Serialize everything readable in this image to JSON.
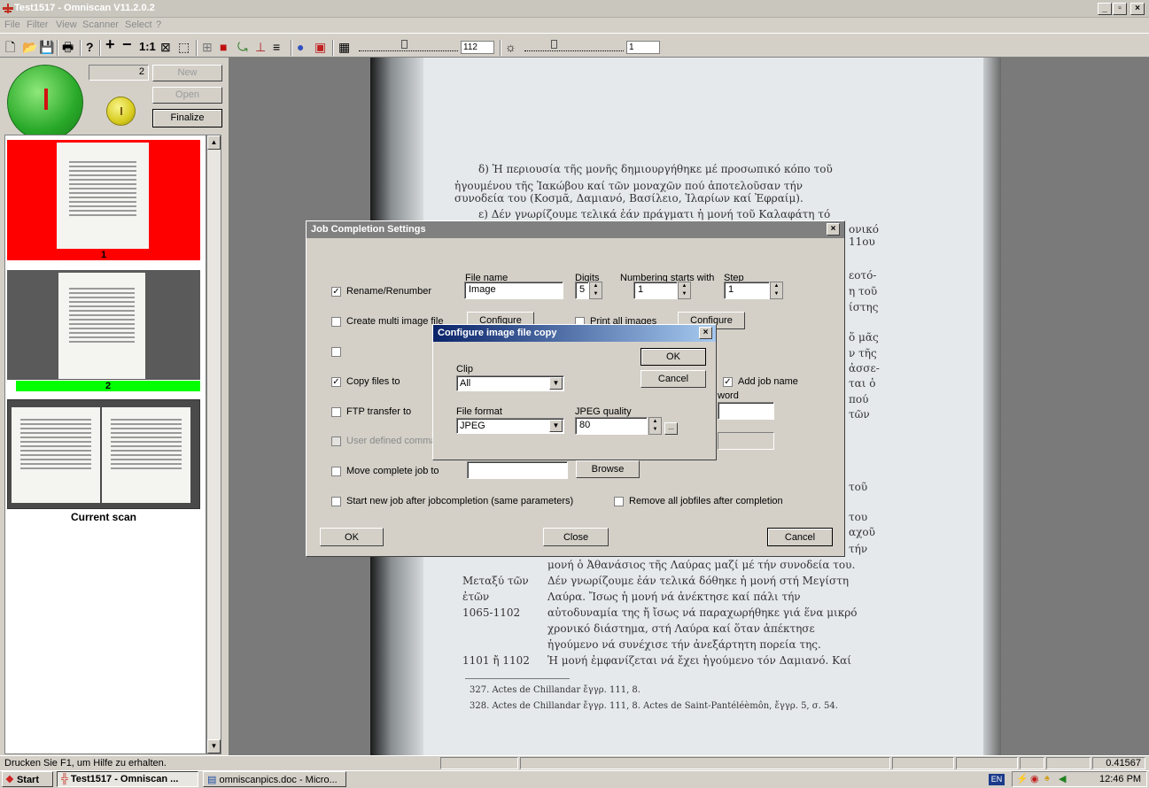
{
  "window": {
    "title": "Test1517 - Omniscan V11.2.0.2"
  },
  "menu": [
    "File",
    "Filter",
    "View",
    "Scanner",
    "Select",
    "?"
  ],
  "toolbar": {
    "zoom_label": "1:1",
    "brightness_value": "112",
    "contrast_value": "1"
  },
  "left_panel": {
    "counter": "2",
    "new_label": "New",
    "open_label": "Open",
    "finalize_label": "Finalize",
    "thumbs": [
      {
        "label": "1",
        "status_color": "#ff0000"
      },
      {
        "label": "2",
        "status_color": "#00ff00"
      }
    ],
    "current_scan_label": "Current scan"
  },
  "page_text": {
    "lines": [
      "δ) Ἡ περιουσία τῆς μονῆς δημιουργήθηκε μέ προσωπικό κόπο τοῦ",
      "ἡγουμένου τῆς Ἰακώβου καί τῶν μοναχῶν πού ἀποτελοῦσαν τήν",
      "συνοδεία του (Κοσμᾶ, Δαμιανό, Βασίλειο, Ἱλαρίων καί Ἐφραίμ).",
      "ε) Δέν γνωρίζουμε τελικά ἐάν πράγματι ἡ μονή τοῦ Καλαφάτη τό"
    ],
    "right_fragments": [
      "ονικό",
      "11ου",
      "εοτό-",
      "η τοῦ",
      "ίστης",
      "ὅ μᾶς",
      "ν τῆς",
      "ἀσσε-",
      "ται ὁ",
      "πού",
      "τῶν",
      "τοῦ",
      "του",
      "αχοῦ",
      "τήν"
    ],
    "lower_lines": [
      "μονή ὁ Ἀθανάσιος τῆς Λαύρας μαζί μέ τήν συνοδεία του.",
      "Δέν γνωρίζουμε ἐάν τελικά δόθηκε ἡ μονή στή Μεγίστη",
      "Λαύρα. Ἴσως ἡ μονή νά ἀνέκτησε καί πάλι τήν",
      "αὐτοδυναμία της ἤ ἴσως νά παραχωρήθηκε γιά ἕνα μικρό",
      "χρονικό διάστημα, στή Λαύρα καί ὅταν ἀπέκτησε",
      "ἡγούμενο νά συνέχισε τήν ἀνεξάρτητη πορεία της.",
      "Ἡ μονή ἐμφανίζεται νά ἔχει ἡγούμενο τόν Δαμιανό. Καί"
    ],
    "margin_notes": [
      "Μεταξύ τῶν",
      "ἐτῶν",
      "1065-1102",
      "1101 ἤ 1102"
    ],
    "footnotes": [
      "327. Actes de Chillandar ἔγγρ. 111, 8.",
      "328. Actes de Chillandar ἔγγρ. 111, 8. Actes de Saint-Pantéléèmôn, ἔγγρ. 5, σ. 54."
    ]
  },
  "job_dialog": {
    "title": "Job Completion Settings",
    "file_name_label": "File name",
    "digits_label": "Digits",
    "numbering_label": "Numbering starts with",
    "step_label": "Step",
    "rename_label": "Rename/Renumber",
    "file_name_value": "Image",
    "digits_value": "5",
    "numbering_value": "1",
    "step_value": "1",
    "multi_image_label": "Create multi image file",
    "configure_label": "Configure",
    "print_all_label": "Print all images",
    "configure2_label": "Configure",
    "copy_files_label": "Copy files to",
    "add_job_name_label": "Add job name",
    "word_label": "word",
    "ftp_label": "FTP transfer to",
    "user_defined_label": "User defined comma",
    "move_job_label": "Move complete job to",
    "browse_label": "Browse",
    "start_new_label": "Start new job after jobcompletion (same parameters)",
    "remove_files_label": "Remove all jobfiles after completion",
    "ok_label": "OK",
    "close_label": "Close",
    "cancel_label": "Cancel"
  },
  "copy_dialog": {
    "title": "Configure image file copy",
    "clip_label": "Clip",
    "clip_value": "All",
    "file_format_label": "File format",
    "file_format_value": "JPEG",
    "jpeg_quality_label": "JPEG quality",
    "jpeg_quality_value": "80",
    "ok_label": "OK",
    "cancel_label": "Cancel"
  },
  "statusbar": {
    "help_text": "Drucken Sie F1, um Hilfe zu erhalten.",
    "value": "0.41567"
  },
  "taskbar": {
    "start_label": "Start",
    "tasks": [
      "Test1517 - Omniscan ...",
      "omniscanpics.doc - Micro..."
    ],
    "lang": "EN",
    "clock": "12:46 PM"
  }
}
